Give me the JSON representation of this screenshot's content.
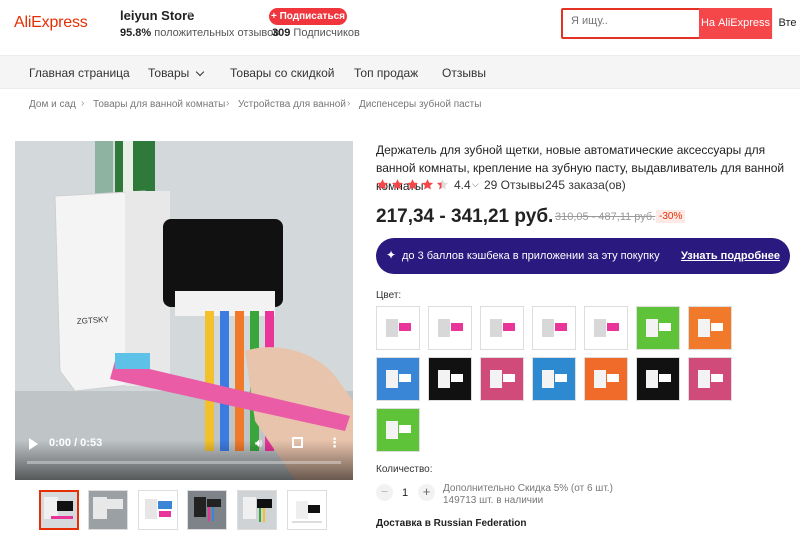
{
  "header": {
    "logo": "AliExpress",
    "store_name": "leiyun Store",
    "store_rating_value": "95.8%",
    "store_rating_label": "положительных отзывов",
    "subscribe_label": "+ Подписаться",
    "subscribers_count": "309",
    "subscribers_label": "Подписчиков",
    "search_placeholder": "Я ищу..",
    "search_aliexpress_label": "На AliExpress",
    "search_store_label": "Вте"
  },
  "nav": {
    "items": [
      "Главная страница",
      "Товары",
      "Товары со скидкой",
      "Топ продаж",
      "Отзывы"
    ]
  },
  "breadcrumb": [
    "Дом и сад",
    "Товары для ванной комнаты",
    "Устройства для ванной",
    "Диспенсеры зубной пасты"
  ],
  "video": {
    "time": "0:00 / 0:53",
    "progress": 0
  },
  "product": {
    "title": "Держатель для зубной щетки, новые автоматические аксессуары для ванной комнаты, крепление на зубную пасту, выдавливатель для ванной комнаты",
    "rating": "4.4",
    "stars_value": 4.4,
    "reviews": "29 Отзывы",
    "orders": "245 заказа(ов)",
    "price": "217,34 - 341,21 руб.",
    "old_price": "310,05 - 487,11 руб.",
    "discount": "-30%",
    "cashback_text": "до 3 баллов кэшбека в приложении за эту покупку",
    "cashback_link": "Узнать подробнее",
    "color_label": "Цвет:",
    "quantity_label": "Количество:",
    "quantity_value": "1",
    "quantity_minus": "−",
    "quantity_plus": "+",
    "quantity_discount": "Дополнительно Скидка 5% (от 6 шт.)",
    "stock": "149713 шт. в наличии",
    "delivery": "Доставка в Russian Federation"
  },
  "colors": {
    "brand": "#e62e04",
    "cashback_bg": "#2a1a80",
    "swatches": [
      "#ffffff",
      "#ffffff",
      "#ffffff",
      "#ffffff",
      "#ffffff",
      "#5fc33a",
      "#f07a2a",
      "#3a86d6",
      "#111111",
      "#d04a7a",
      "#2d8ad0",
      "#f06a2a",
      "#111111",
      "#d04a7a",
      "#5fc33a"
    ]
  }
}
